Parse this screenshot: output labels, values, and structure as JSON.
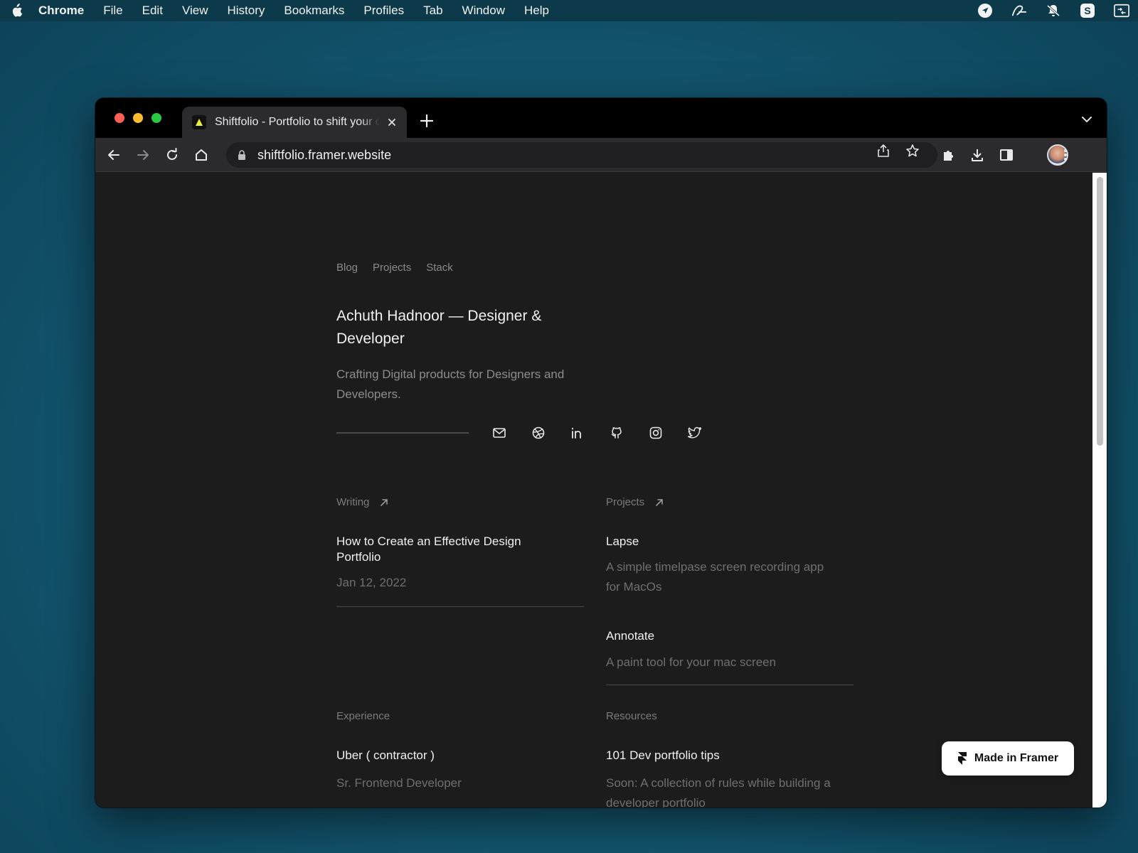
{
  "menubar": {
    "app": "Chrome",
    "items": [
      "File",
      "Edit",
      "View",
      "History",
      "Bookmarks",
      "Profiles",
      "Tab",
      "Window",
      "Help"
    ],
    "tray_icons": [
      "location-arrow-icon",
      "signature-icon",
      "bell-crossed-icon",
      "skype-icon",
      "screen-share-icon"
    ]
  },
  "browser": {
    "tab_title": "Shiftfolio - Portfolio to shift your career",
    "url": "shiftfolio.framer.website"
  },
  "page": {
    "nav": [
      "Blog",
      "Projects",
      "Stack"
    ],
    "hero_title": "Achuth Hadnoor — Designer & Developer",
    "hero_subtitle": "Crafting Digital products for Designers and Developers.",
    "social_icons": [
      "mail-icon",
      "dribbble-icon",
      "linkedin-icon",
      "github-icon",
      "instagram-icon",
      "twitter-icon"
    ],
    "writing": {
      "label": "Writing",
      "posts": [
        {
          "title": "How to Create an Effective Design Portfolio",
          "date": "Jan 12, 2022"
        }
      ]
    },
    "projects": {
      "label": "Projects",
      "items": [
        {
          "title": "Lapse",
          "desc": "A simple timelpase screen recording app for MacOs"
        },
        {
          "title": "Annotate",
          "desc": "A paint tool for your mac screen"
        }
      ]
    },
    "experience": {
      "label": "Experience",
      "items": [
        {
          "title": "Uber ( contractor )",
          "role": "Sr. Frontend Developer"
        }
      ]
    },
    "resources": {
      "label": "Resources",
      "items": [
        {
          "title": "101 Dev portfolio tips",
          "desc": "Soon: A collection of rules while building a developer portfolio"
        }
      ]
    },
    "framer_badge": "Made in Framer"
  },
  "colors": {
    "page_bg": "#1c1c1c",
    "text_primary": "#f1f1f1",
    "text_muted": "#6f6f6f",
    "divider": "#4a4a4a"
  }
}
